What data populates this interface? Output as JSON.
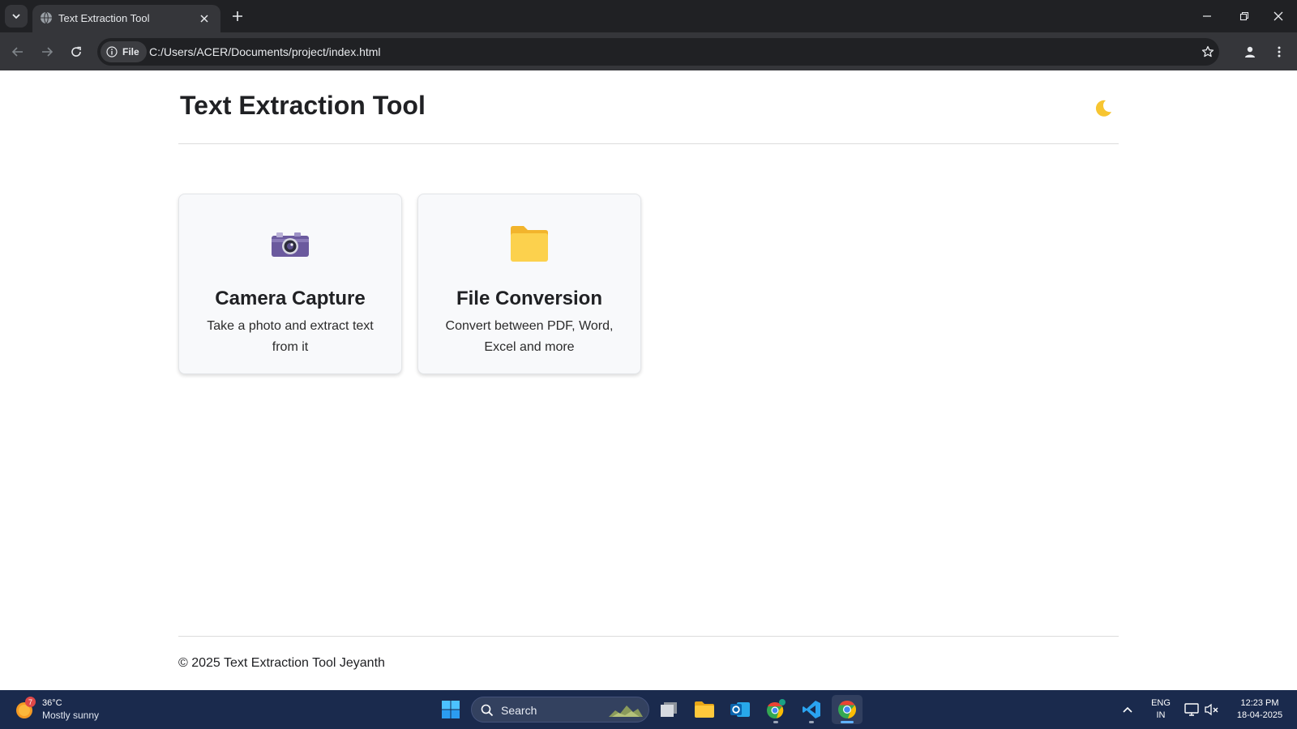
{
  "browser": {
    "tab_title": "Text Extraction Tool",
    "site_chip_label": "File",
    "url": "C:/Users/ACER/Documents/project/index.html"
  },
  "page": {
    "title": "Text Extraction Tool",
    "theme_toggle_icon": "moon-icon",
    "cards": [
      {
        "title": "Camera Capture",
        "description": "Take a photo and extract text from it",
        "icon": "camera-icon"
      },
      {
        "title": "File Conversion",
        "description": "Convert between PDF, Word, Excel and more",
        "icon": "folder-icon"
      }
    ],
    "footer": "© 2025 Text Extraction Tool Jeyanth"
  },
  "taskbar": {
    "weather_temp": "36°C",
    "weather_desc": "Mostly sunny",
    "weather_badge": "7",
    "search_label": "Search",
    "lang_line1": "ENG",
    "lang_line2": "IN",
    "time": "12:23 PM",
    "date": "18-04-2025"
  },
  "colors": {
    "chrome_dark": "#202124",
    "chrome_toolbar": "#35363a",
    "card_bg": "#f8f9fb",
    "taskbar_bg": "#1a2a4d",
    "folder_yellow": "#fcd14d",
    "moon_yellow": "#f7c531"
  }
}
